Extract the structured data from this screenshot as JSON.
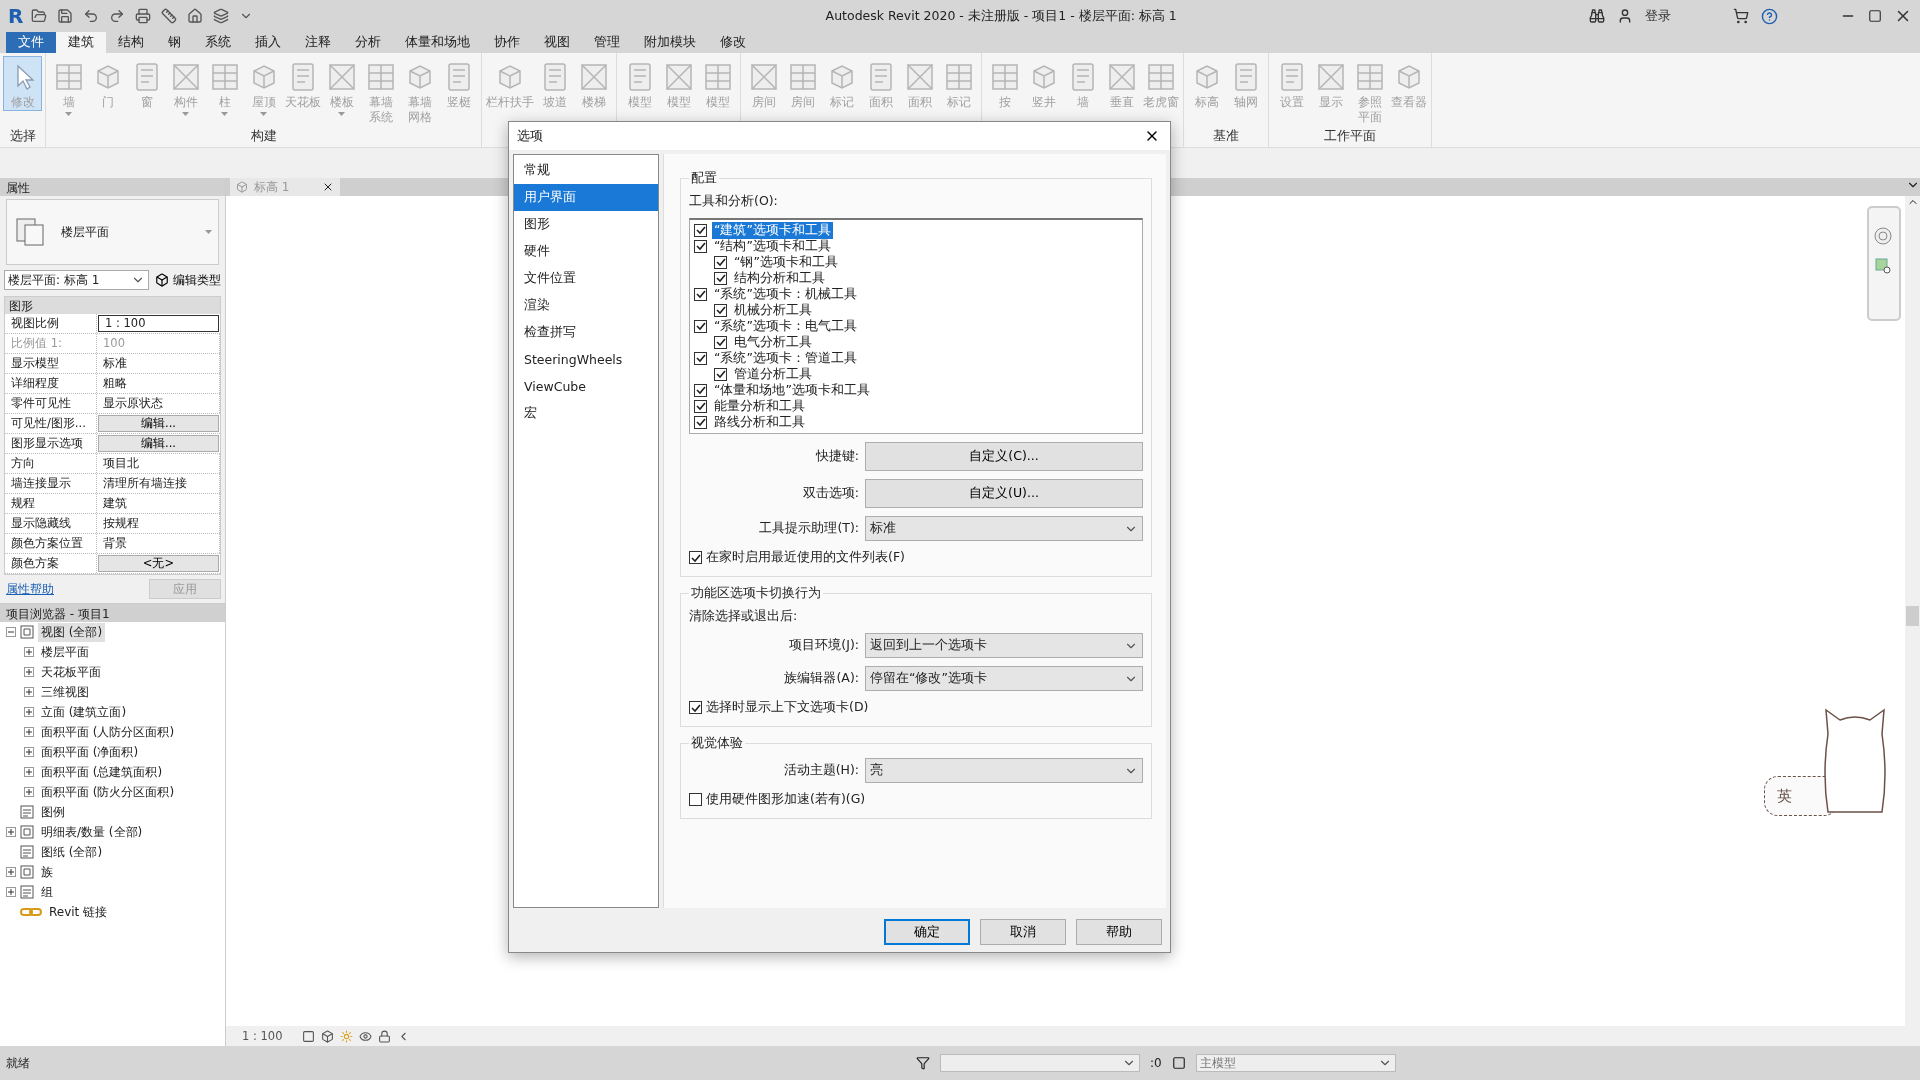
{
  "app": {
    "logo": "R",
    "title": "Autodesk Revit 2020 - 未注册版 - 项目1 - 楼层平面: 标高 1",
    "sign_in": "登录"
  },
  "menu_tabs": [
    {
      "label": "文件",
      "kind": "app"
    },
    {
      "label": "建筑",
      "kind": "tab",
      "selected": true
    },
    {
      "label": "结构",
      "kind": "tab",
      "selected": false
    },
    {
      "label": "钢",
      "kind": "tab",
      "selected": false
    },
    {
      "label": "系统",
      "kind": "tab",
      "selected": false
    },
    {
      "label": "插入",
      "kind": "tab",
      "selected": false
    },
    {
      "label": "注释",
      "kind": "tab",
      "selected": false
    },
    {
      "label": "分析",
      "kind": "tab",
      "selected": false
    },
    {
      "label": "体量和场地",
      "kind": "tab",
      "selected": false
    },
    {
      "label": "协作",
      "kind": "tab",
      "selected": false
    },
    {
      "label": "视图",
      "kind": "tab",
      "selected": false
    },
    {
      "label": "管理",
      "kind": "tab",
      "selected": false
    },
    {
      "label": "附加模块",
      "kind": "tab",
      "selected": false
    },
    {
      "label": "修改",
      "kind": "tab",
      "selected": false
    }
  ],
  "ribbon": {
    "groups": [
      {
        "label": "选择",
        "buttons": [
          {
            "label": "修改",
            "selected": true
          }
        ]
      },
      {
        "label": "构建",
        "buttons": [
          {
            "label": "墙",
            "dropdown": true,
            "selected": false
          },
          {
            "label": "门",
            "selected": false
          },
          {
            "label": "窗",
            "selected": false
          },
          {
            "label": "构件",
            "dropdown": true,
            "selected": false
          },
          {
            "label": "柱",
            "dropdown": true,
            "selected": false
          },
          {
            "label": "屋顶",
            "dropdown": true,
            "selected": false
          },
          {
            "label": "天花板",
            "selected": false
          },
          {
            "label": "楼板",
            "dropdown": true,
            "selected": false
          },
          {
            "label": [
              "幕墙",
              "系统"
            ],
            "selected": false
          },
          {
            "label": [
              "幕墙",
              "网格"
            ],
            "selected": false
          },
          {
            "label": "竖梃",
            "selected": false
          }
        ]
      },
      {
        "buttons": [
          {
            "label": "栏杆扶手",
            "selected": false
          },
          {
            "label": "坡道",
            "selected": false
          },
          {
            "label": "楼梯",
            "selected": false
          }
        ]
      },
      {
        "buttons": [
          {
            "label": "模型",
            "selected": false
          },
          {
            "label": "模型",
            "selected": false
          },
          {
            "label": "模型",
            "selected": false
          }
        ]
      },
      {
        "buttons": [
          {
            "label": "房间",
            "selected": false
          },
          {
            "label": "房间",
            "selected": false
          },
          {
            "label": "标记",
            "selected": false
          },
          {
            "label": "面积",
            "selected": false
          },
          {
            "label": "面积",
            "selected": false
          },
          {
            "label": "标记",
            "selected": false
          }
        ]
      },
      {
        "buttons": [
          {
            "label": "按",
            "selected": false
          },
          {
            "label": "竖井",
            "selected": false
          },
          {
            "label": "墙",
            "selected": false
          },
          {
            "label": "垂直",
            "selected": false
          },
          {
            "label": "老虎窗",
            "selected": false
          }
        ]
      },
      {
        "label": "基准",
        "buttons": [
          {
            "label": "标高",
            "selected": false
          },
          {
            "label": "轴网",
            "selected": false
          }
        ]
      },
      {
        "label": "工作平面",
        "buttons": [
          {
            "label": "设置",
            "selected": false
          },
          {
            "label": "显示",
            "selected": false
          },
          {
            "label": [
              "参照",
              "平面"
            ],
            "selected": false
          },
          {
            "label": "查看器",
            "selected": false
          }
        ]
      }
    ]
  },
  "properties": {
    "title": "属性",
    "type_name": "楼层平面",
    "instance": "楼层平面: 标高 1",
    "edit_type": "编辑类型",
    "section": "图形",
    "rows": [
      {
        "name": "视图比例",
        "value": "1 : 100",
        "kind": "field"
      },
      {
        "name": "比例值 1:",
        "value": "100",
        "kind": "readonly"
      },
      {
        "name": "显示模型",
        "value": "标准",
        "kind": "text"
      },
      {
        "name": "详细程度",
        "value": "粗略",
        "kind": "text"
      },
      {
        "name": "零件可见性",
        "value": "显示原状态",
        "kind": "text"
      },
      {
        "name": "可见性/图形...",
        "value": "编辑...",
        "kind": "button"
      },
      {
        "name": "图形显示选项",
        "value": "编辑...",
        "kind": "button"
      },
      {
        "name": "方向",
        "value": "项目北",
        "kind": "text"
      },
      {
        "name": "墙连接显示",
        "value": "清理所有墙连接",
        "kind": "text"
      },
      {
        "name": "规程",
        "value": "建筑",
        "kind": "text"
      },
      {
        "name": "显示隐藏线",
        "value": "按规程",
        "kind": "text"
      },
      {
        "name": "颜色方案位置",
        "value": "背景",
        "kind": "text"
      },
      {
        "name": "颜色方案",
        "value": "<无>",
        "kind": "button"
      }
    ],
    "help_link": "属性帮助",
    "apply": "应用"
  },
  "project_browser": {
    "title": "项目浏览器 - 项目1",
    "items": [
      {
        "label": "视图 (全部)",
        "expanded": true,
        "selected": true,
        "children": [
          {
            "label": "楼层平面",
            "expanded": false,
            "selected": false
          },
          {
            "label": "天花板平面",
            "expanded": false,
            "selected": false
          },
          {
            "label": "三维视图",
            "expanded": false,
            "selected": false
          },
          {
            "label": "立面 (建筑立面)",
            "expanded": false,
            "selected": false
          },
          {
            "label": "面积平面 (人防分区面积)",
            "expanded": false,
            "selected": false
          },
          {
            "label": "面积平面 (净面积)",
            "expanded": false,
            "selected": false
          },
          {
            "label": "面积平面 (总建筑面积)",
            "expanded": false,
            "selected": false
          },
          {
            "label": "面积平面 (防火分区面积)",
            "expanded": false,
            "selected": false
          }
        ]
      },
      {
        "label": "图例",
        "selected": false
      },
      {
        "label": "明细表/数量 (全部)",
        "expanded": false,
        "selected": false
      },
      {
        "label": "图纸 (全部)",
        "selected": false
      },
      {
        "label": "族",
        "expanded": false,
        "selected": false
      },
      {
        "label": "组",
        "expanded": false,
        "selected": false
      },
      {
        "label": "Revit 链接",
        "selected": false
      }
    ]
  },
  "view_tab": {
    "label": "标高 1"
  },
  "view_bar": {
    "scale": "1 : 100"
  },
  "status_bar": {
    "status": "就绪",
    "count": ":0",
    "model": "主模型"
  },
  "ime_indicator": "英",
  "dialog": {
    "title": "选项",
    "nav": [
      {
        "label": "常规",
        "selected": false
      },
      {
        "label": "用户界面",
        "selected": true
      },
      {
        "label": "图形",
        "selected": false
      },
      {
        "label": "硬件",
        "selected": false
      },
      {
        "label": "文件位置",
        "selected": false
      },
      {
        "label": "渲染",
        "selected": false
      },
      {
        "label": "检查拼写",
        "selected": false
      },
      {
        "label": "SteeringWheels",
        "selected": false
      },
      {
        "label": "ViewCube",
        "selected": false
      },
      {
        "label": "宏",
        "selected": false
      }
    ],
    "config": {
      "legend": "配置",
      "tools_label": "工具和分析(O):",
      "tools": [
        {
          "label": "“建筑”选项卡和工具",
          "checked": true,
          "selected": true
        },
        {
          "label": "“结构”选项卡和工具",
          "checked": true,
          "selected": false,
          "children": [
            {
              "label": "“钢”选项卡和工具",
              "checked": true,
              "selected": false
            },
            {
              "label": "结构分析和工具",
              "checked": true,
              "selected": false
            }
          ]
        },
        {
          "label": "“系统”选项卡：机械工具",
          "checked": true,
          "selected": false,
          "children": [
            {
              "label": "机械分析工具",
              "checked": true,
              "selected": false
            }
          ]
        },
        {
          "label": "“系统”选项卡：电气工具",
          "checked": true,
          "selected": false,
          "children": [
            {
              "label": "电气分析工具",
              "checked": true,
              "selected": false
            }
          ]
        },
        {
          "label": "“系统”选项卡：管道工具",
          "checked": true,
          "selected": false,
          "children": [
            {
              "label": "管道分析工具",
              "checked": true,
              "selected": false
            }
          ]
        },
        {
          "label": "“体量和场地”选项卡和工具",
          "checked": true,
          "selected": false
        },
        {
          "label": "能量分析和工具",
          "checked": true,
          "selected": false
        },
        {
          "label": "路线分析和工具",
          "checked": true,
          "selected": false
        }
      ],
      "fields": [
        {
          "label": "快捷键:",
          "kind": "button",
          "value": "自定义(C)..."
        },
        {
          "label": "双击选项:",
          "kind": "button",
          "value": "自定义(U)..."
        },
        {
          "label": "工具提示助理(T):",
          "kind": "select",
          "value": "标准"
        }
      ],
      "checkbox": {
        "label": "在家时启用最近使用的文件列表(F)",
        "checked": true
      }
    },
    "ribbon_switch": {
      "legend": "功能区选项卡切换行为",
      "note": "清除选择或退出后:",
      "fields": [
        {
          "label": "项目环境(J):",
          "kind": "select",
          "value": "返回到上一个选项卡"
        },
        {
          "label": "族编辑器(A):",
          "kind": "select",
          "value": "停留在“修改”选项卡"
        }
      ],
      "checkbox": {
        "label": "选择时显示上下文选项卡(D)",
        "checked": true
      }
    },
    "visual": {
      "legend": "视觉体验",
      "fields": [
        {
          "label": "活动主题(H):",
          "kind": "select",
          "value": "亮"
        }
      ],
      "checkbox": {
        "label": "使用硬件图形加速(若有)(G)",
        "checked": false
      }
    },
    "buttons": [
      {
        "label": "确定",
        "default": true
      },
      {
        "label": "取消",
        "default": false
      },
      {
        "label": "帮助",
        "default": false
      }
    ]
  }
}
